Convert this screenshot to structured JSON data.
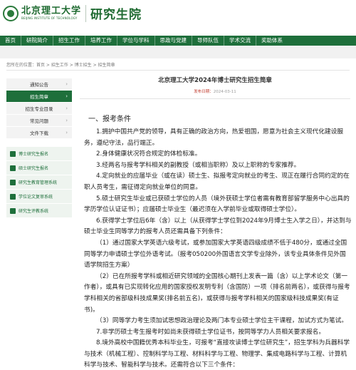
{
  "header": {
    "logo_cn": "北京理工大学",
    "logo_en": "BEIJING INSTITUTE OF TECHNOLOGY",
    "site_name": "研究生院"
  },
  "nav": {
    "items": [
      "首页",
      "研院简介",
      "招生工作",
      "培养工作",
      "学位与学科",
      "思政与党建",
      "导师队伍",
      "学术交流",
      "奖助体系"
    ]
  },
  "breadcrumb": "您所在的位置：首页 > 招生工作 > 博士招生 > 招生简章",
  "sidebar": {
    "items": [
      {
        "label": "通知公告",
        "active": false
      },
      {
        "label": "招生简章",
        "active": true
      },
      {
        "label": "招生专业目录",
        "active": false
      },
      {
        "label": "常见问题",
        "active": false
      },
      {
        "label": "文件下载",
        "active": false
      }
    ],
    "links": [
      "博士研究生报名",
      "硕士研究生报名",
      "研究生教育管理系统",
      "学位论文复审系统",
      "研究生评教系统"
    ]
  },
  "article": {
    "title": "北京理工大学2024年博士研究生招生简章",
    "pub_label": "发布日期：",
    "pub_date": "2024-03-11",
    "section_title": "一、报考条件",
    "paragraphs": [
      "1.拥护中国共产党的领导，具有正确的政治方向，热爱祖国，愿意为社会主义现代化建设服务，遵纪守法，品行端正。",
      "2.身体健康状况符合规定的体检标准。",
      "3.经两名与报考学科相关的副教授（或相当职称）及以上职称的专家推荐。",
      "4.定向就业的应届毕业（或在读）硕士生、拟报考定向就业的考生、现正在履行合同约定的在职人员考生，需征得定向就业单位的同意。",
      "5.硕士研究生毕业或已获硕士学位的人员（境外获硕士学位者需有教育部留学服务中心出具的学历学位认证证书）；应届硕士毕业生（最迟须在入学前毕业或取得硕士学位）。",
      "6.获得学士学位后6年（含）以上（从获得学士学位到2024年9月博士生入学之日），并达到与硕士毕业生同等学力的报考人员还需具备下列条件：",
      "（1）通过国家大学英语六级考试，或参加国家大学英语四级成绩不低于480分，或通过全国同等学力申请硕士学位外语考试。（报考050200外国语言文学专业除外，该专业具体条件见外国语学院招生方案）",
      "（2）已在所报考学科或相近研究领域的全国核心期刊上发表一篇（含）以上学术论文（第一作者），或具有已实现转化应用的国家授权发明专利（含国防）一项（排名前两名），或获得与报考学科相关的省部级科技成果奖(排名前五名)，或获得与报考学科相关的国家级科技成果奖(有证书)。",
      "（3）同等学力考生须加试思想政治理论及两门本专业硕士学位主干课程，加试方式为笔试。",
      "7.非学历硕士考生报考时如尚未获得硕士学位证书，按同等学力人员相关要求报名。",
      "8.境外高校中国籍优秀本科毕业生，可报考“直接攻读博士学位研究生”，招生学科为兵器科学与技术（机械工程）、控制科学与工程、材料科学与工程、物理学、集成电路科学与工程、计算机科学与技术、智能科学与技术。还需符合以下三个条件："
    ]
  },
  "colors": {
    "brand_green": "#1e6f3b",
    "date_red": "#c0392b"
  }
}
